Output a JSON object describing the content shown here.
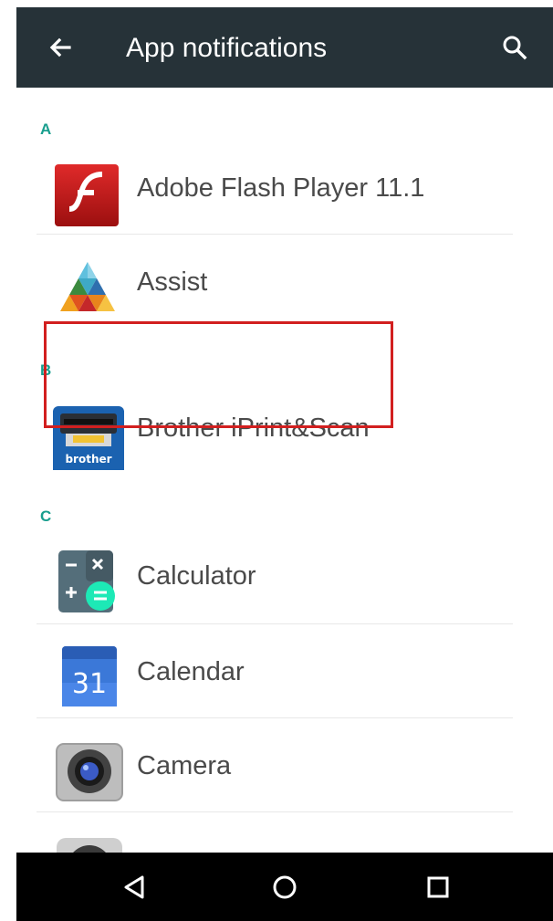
{
  "toolbar": {
    "title": "App notifications",
    "back_icon": "arrow-back-icon",
    "search_icon": "search-icon",
    "background": "#263238"
  },
  "sections": [
    {
      "letter": "A",
      "apps": [
        {
          "name": "Adobe Flash Player 11.1",
          "icon": "flash-icon"
        },
        {
          "name": "Assist",
          "icon": "assist-icon",
          "highlighted": true
        }
      ]
    },
    {
      "letter": "B",
      "apps": [
        {
          "name": "Brother iPrint&Scan",
          "icon": "brother-icon",
          "icon_text": "brother"
        }
      ]
    },
    {
      "letter": "C",
      "apps": [
        {
          "name": "Calculator",
          "icon": "calculator-icon"
        },
        {
          "name": "Calendar",
          "icon": "calendar-icon",
          "icon_text": "31"
        },
        {
          "name": "Camera",
          "icon": "camera-icon"
        }
      ]
    }
  ],
  "navbar": {
    "back": "nav-back-icon",
    "home": "nav-home-icon",
    "recents": "nav-recents-icon"
  },
  "colors": {
    "section_header": "#199e8e",
    "highlight_box": "#d21f1f",
    "navbar": "#000000"
  }
}
